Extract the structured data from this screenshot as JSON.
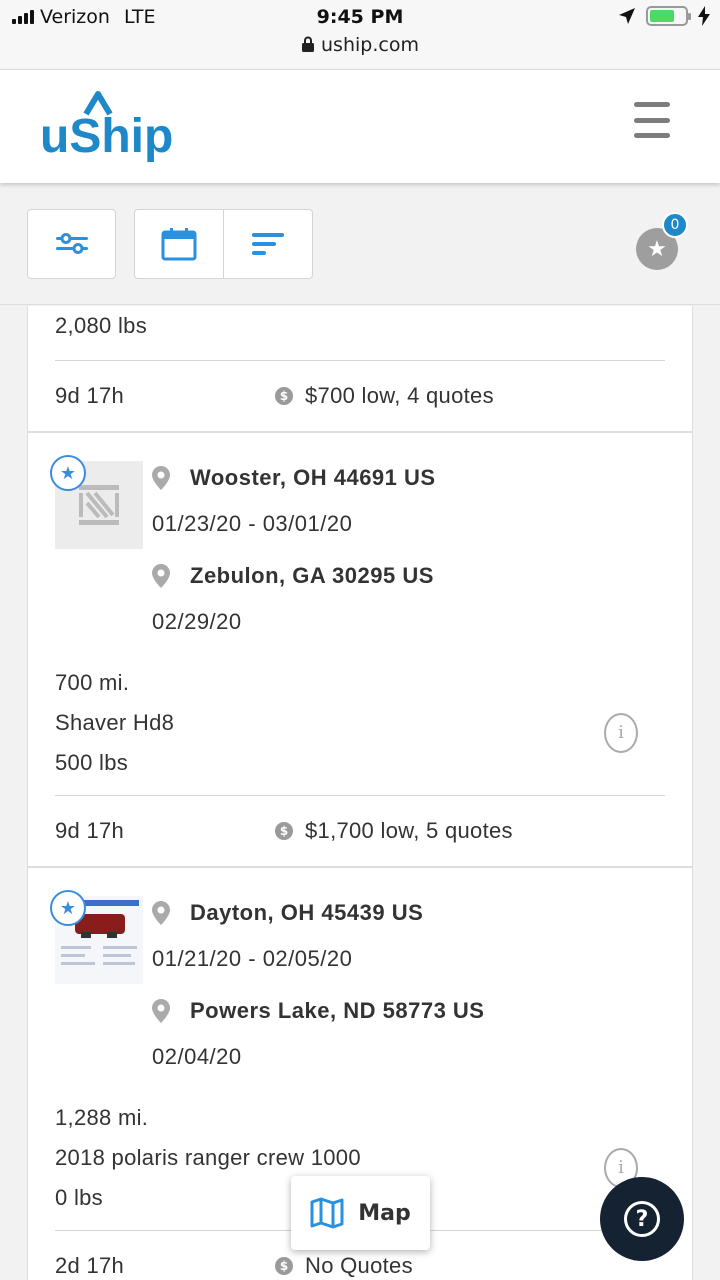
{
  "status_bar": {
    "carrier": "Verizon",
    "network": "LTE",
    "time": "9:45 PM",
    "url": "uship.com"
  },
  "header": {
    "logo_text": "uShip",
    "menu_icon": "hamburger-icon",
    "brand_color": "#1e88c8"
  },
  "toolbar": {
    "filter_icon": "sliders-icon",
    "date_icon": "calendar-icon",
    "sort_icon": "sort-icon",
    "saved_count": "0"
  },
  "listings": [
    {
      "partial": true,
      "weight": "2,080 lbs",
      "time_left": "9d 17h",
      "quote_summary": "$700 low, 4 quotes"
    },
    {
      "pickup": "Wooster, OH 44691 US",
      "pickup_dates": "01/23/20 - 03/01/20",
      "dropoff": "Zebulon, GA 30295 US",
      "dropoff_date": "02/29/20",
      "distance": "700 mi.",
      "item": "Shaver Hd8",
      "weight": "500 lbs",
      "time_left": "9d 17h",
      "quote_summary": "$1,700 low, 5 quotes"
    },
    {
      "pickup": "Dayton, OH 45439 US",
      "pickup_dates": "01/21/20 - 02/05/20",
      "dropoff": "Powers Lake, ND 58773 US",
      "dropoff_date": "02/04/20",
      "distance": "1,288 mi.",
      "item": "2018 polaris ranger crew 1000",
      "weight": "0 lbs",
      "time_left": "2d 17h",
      "quote_summary": "No Quotes"
    }
  ],
  "floating": {
    "map_label": "Map",
    "help_label": "?"
  }
}
